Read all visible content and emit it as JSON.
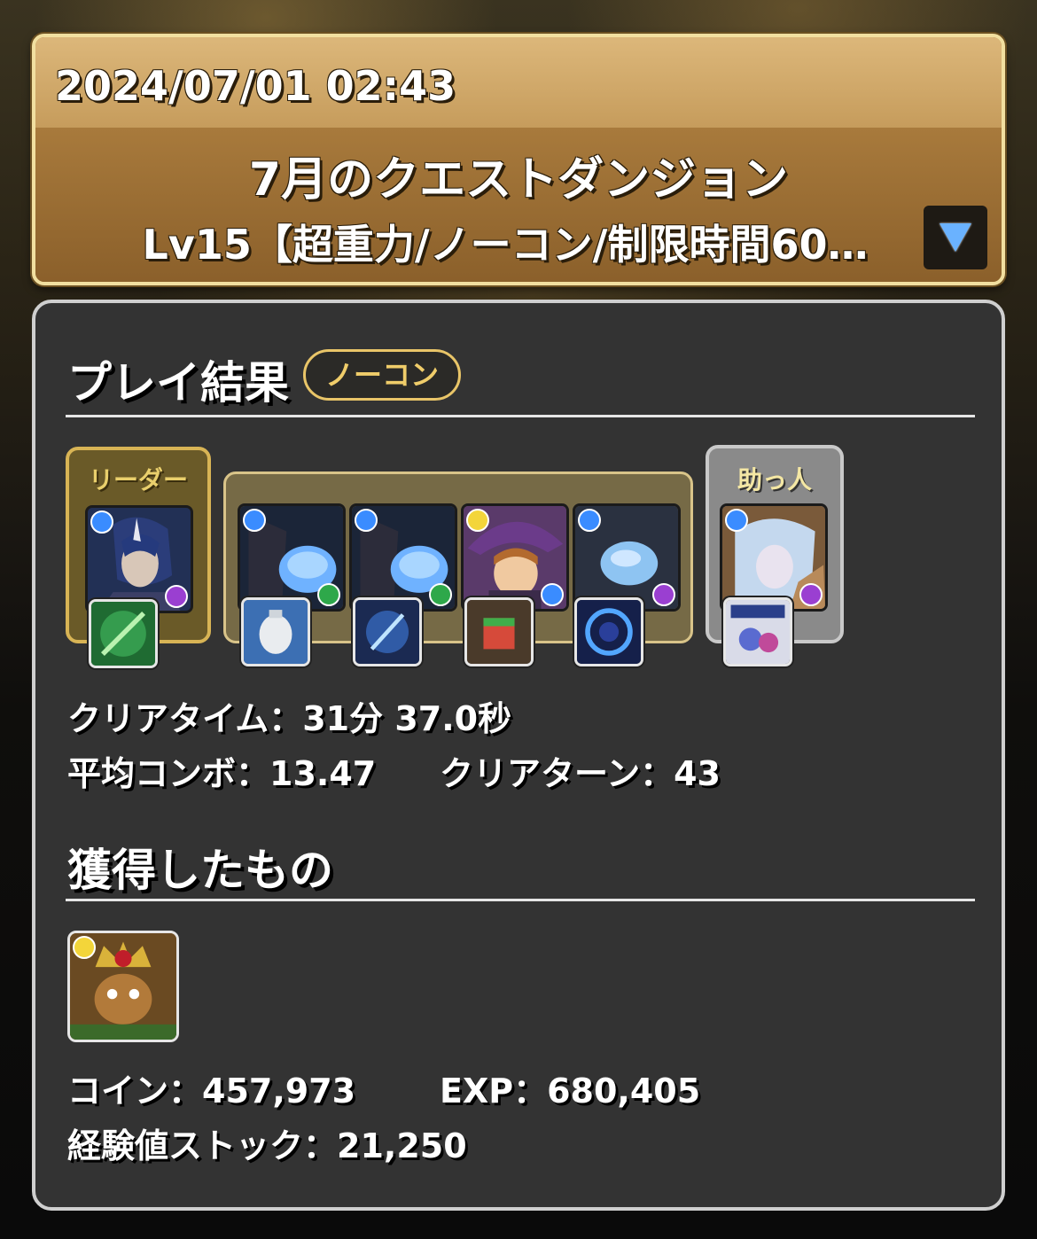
{
  "header": {
    "date": "2024/07/01 02:43",
    "dungeon_name": "7月のクエストダンジョン",
    "floor_name": "Lv15【超重力/ノーコン/制限時間60…",
    "expand_icon": "triangle-down-icon"
  },
  "result": {
    "title": "プレイ結果",
    "badge": "ノーコン",
    "leader_label": "リーダー",
    "helper_label": "助っ人",
    "clear_time": "クリアタイム：31分 37.0秒",
    "avg_combo": "平均コンボ：13.47",
    "clear_turns": "クリアターン：43"
  },
  "rewards": {
    "title": "獲得したもの",
    "coins": "コイン：457,973",
    "exp": "EXP：680,405",
    "exp_stock": "経験値ストック：21,250"
  },
  "colors": {
    "header_gold": "#c69c5c",
    "panel_bg": "#333333",
    "badge_gold": "#f0cd6a",
    "water": "#3a8cff",
    "dark": "#9a3fd1",
    "wood": "#2ea84a",
    "light": "#f3d53a"
  }
}
